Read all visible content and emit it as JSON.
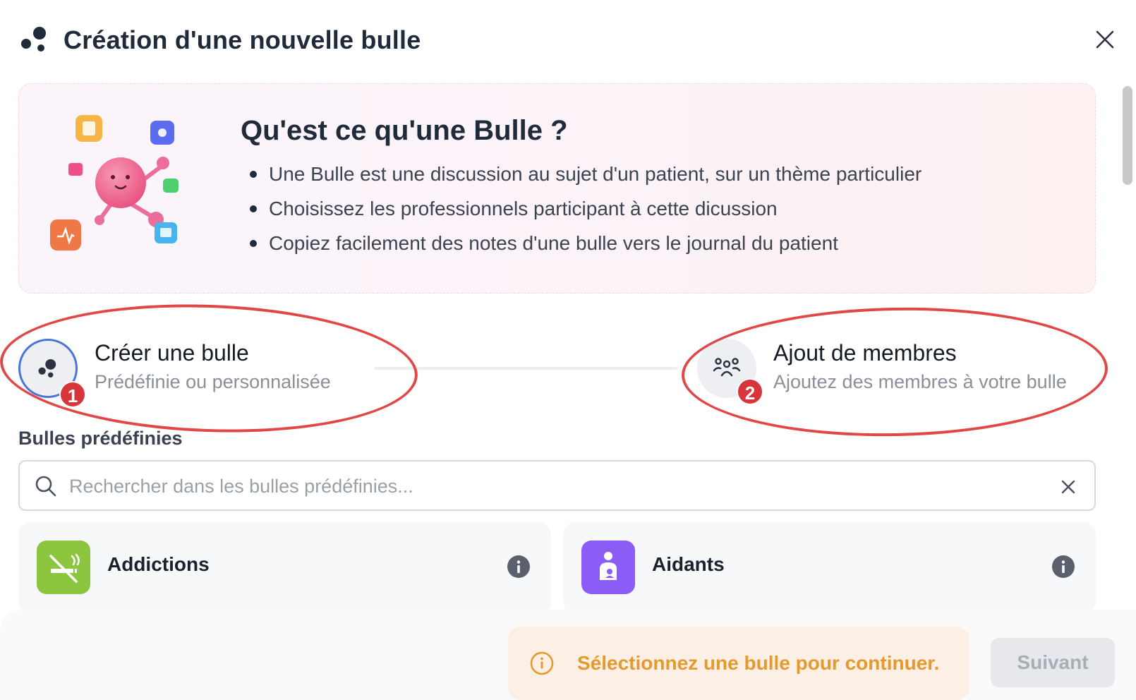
{
  "header": {
    "title": "Création d'une nouvelle bulle",
    "logo_icon": "bubbles-logo-icon",
    "close_icon": "close-icon"
  },
  "intro": {
    "heading": "Qu'est ce qu'une Bulle ?",
    "bullets": [
      "Une Bulle est une discussion au sujet d'un patient, sur un thème particulier",
      "Choisissez les professionnels participant à cette dicussion",
      "Copiez facilement des notes d'une bulle vers le journal du patient"
    ]
  },
  "stepper": {
    "steps": [
      {
        "number": "1",
        "title": "Créer une bulle",
        "subtitle": "Prédéfinie ou personnalisée",
        "icon": "bubbles-icon",
        "active": true
      },
      {
        "number": "2",
        "title": "Ajout de membres",
        "subtitle": "Ajoutez des membres à votre bulle",
        "icon": "group-icon",
        "active": false
      }
    ]
  },
  "predefined": {
    "label": "Bulles prédéfinies",
    "search": {
      "placeholder": "Rechercher dans les bulles prédéfinies...",
      "value": ""
    },
    "items": [
      {
        "name": "Addictions",
        "icon": "no-smoking-icon",
        "color": "#8cc63f"
      },
      {
        "name": "Aidants",
        "icon": "caregiver-icon",
        "color": "#8b5cf6"
      }
    ]
  },
  "footer": {
    "alert_text": "Sélectionnez une bulle pour continuer.",
    "alert_color": "#e59a2e",
    "next_label": "Suivant"
  },
  "colors": {
    "accent_blue": "#4a74d6",
    "badge_red": "#d8353a",
    "annotation_red": "#e04848"
  }
}
